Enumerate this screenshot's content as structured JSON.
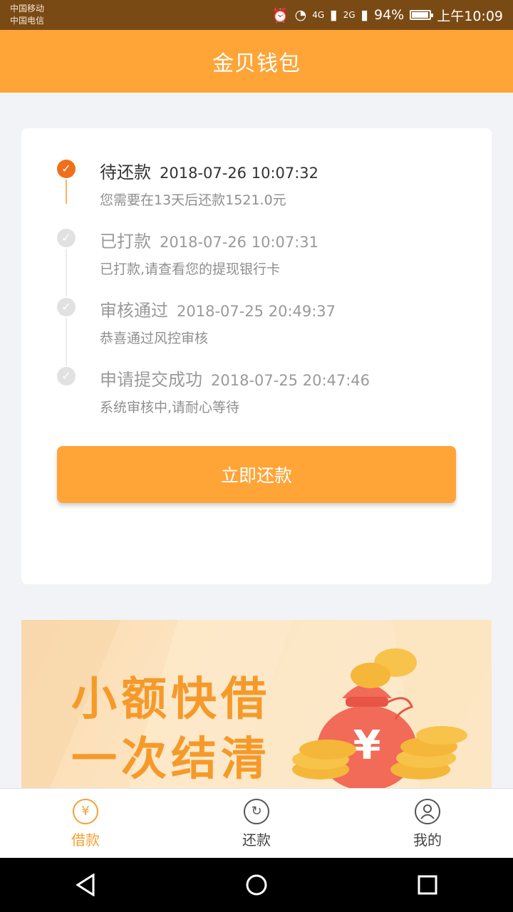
{
  "status_bar": {
    "carrier_1": "中国移动",
    "carrier_2": "中国电信",
    "network_1": "4G",
    "network_2": "2G",
    "battery": "94%",
    "battery_level": 0.94,
    "time": "上午10:09"
  },
  "header": {
    "title": "金贝钱包"
  },
  "timeline": {
    "steps": [
      {
        "title": "待还款",
        "time": "2018-07-26 10:07:32",
        "desc": "您需要在13天后还款1521.0元"
      },
      {
        "title": "已打款",
        "time": "2018-07-26 10:07:31",
        "desc": "已打款,请查看您的提现银行卡"
      },
      {
        "title": "审核通过",
        "time": "2018-07-25 20:49:37",
        "desc": "恭喜通过风控审核"
      },
      {
        "title": "申请提交成功",
        "time": "2018-07-25 20:47:46",
        "desc": "系统审核中,请耐心等待"
      }
    ]
  },
  "repay_button": {
    "label": "立即还款"
  },
  "banner": {
    "line_1": "小额快借",
    "line_2": "一次结清"
  },
  "tabs": [
    {
      "label": "借款",
      "icon": "money-bag-icon"
    },
    {
      "label": "还款",
      "icon": "repay-icon"
    },
    {
      "label": "我的",
      "icon": "user-icon"
    }
  ],
  "colors": {
    "brand": "#ffa436",
    "active_dot": "#f06f1b"
  }
}
